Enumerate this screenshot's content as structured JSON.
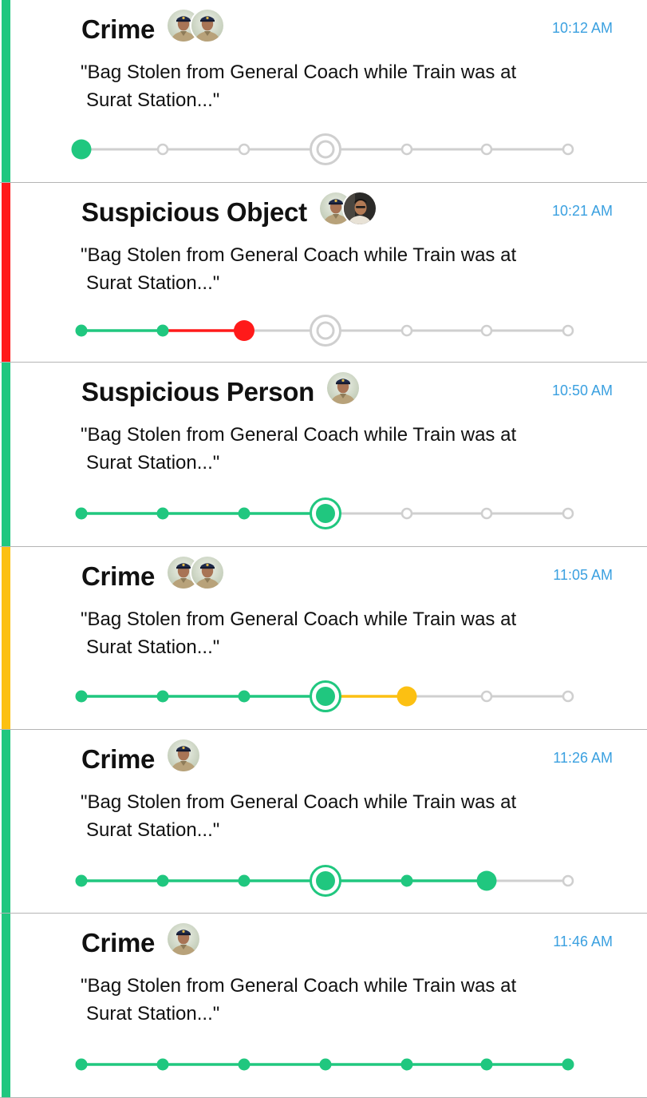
{
  "colors": {
    "green": "#20c77f",
    "red": "#ff1a1a",
    "yellow": "#fcc012",
    "grey": "#cfcfcf",
    "time": "#3aa0e0"
  },
  "incidents": [
    {
      "title": "Crime",
      "time": "10:12 AM",
      "desc_line1": "\"Bag Stolen from General Coach while Train was at",
      "desc_line2": "Surat Station...\"",
      "status_color": "green",
      "avatars": [
        "officer-photo",
        "officer-photo"
      ],
      "progress": {
        "nodes": [
          "active-green",
          "pending",
          "pending",
          "milestone-pending",
          "pending",
          "pending",
          "pending"
        ],
        "segments": [
          "grey",
          "grey",
          "grey",
          "grey",
          "grey",
          "grey"
        ]
      }
    },
    {
      "title": "Suspicious Object",
      "time": "10:21 AM",
      "desc_line1": "\"Bag Stolen from General Coach while Train was at",
      "desc_line2": "Surat Station...\"",
      "status_color": "red",
      "avatars": [
        "officer-photo",
        "person-photo"
      ],
      "progress": {
        "nodes": [
          "done-green",
          "done-green",
          "active-red",
          "milestone-pending",
          "pending",
          "pending",
          "pending"
        ],
        "segments": [
          "green",
          "red",
          "grey",
          "grey",
          "grey",
          "grey"
        ]
      }
    },
    {
      "title": "Suspicious Person",
      "time": "10:50 AM",
      "desc_line1": "\"Bag Stolen from General Coach while Train was at",
      "desc_line2": "Surat Station...\"",
      "status_color": "green",
      "avatars": [
        "officer-photo"
      ],
      "progress": {
        "nodes": [
          "done-green",
          "done-green",
          "done-green",
          "milestone-active",
          "pending",
          "pending",
          "pending"
        ],
        "segments": [
          "green",
          "green",
          "green",
          "grey",
          "grey",
          "grey"
        ]
      }
    },
    {
      "title": "Crime",
      "time": "11:05 AM",
      "desc_line1": "\"Bag Stolen from General Coach while Train was at",
      "desc_line2": "Surat Station...\"",
      "status_color": "yellow",
      "avatars": [
        "officer-photo",
        "officer-photo"
      ],
      "progress": {
        "nodes": [
          "done-green",
          "done-green",
          "done-green",
          "milestone-active",
          "active-yellow",
          "pending",
          "pending"
        ],
        "segments": [
          "green",
          "green",
          "green",
          "yellow",
          "grey",
          "grey"
        ]
      }
    },
    {
      "title": "Crime",
      "time": "11:26 AM",
      "desc_line1": "\"Bag Stolen from General Coach while Train was at",
      "desc_line2": "Surat Station...\"",
      "status_color": "green",
      "avatars": [
        "officer-photo"
      ],
      "progress": {
        "nodes": [
          "done-green",
          "done-green",
          "done-green",
          "milestone-active",
          "done-green",
          "active-green",
          "pending"
        ],
        "segments": [
          "green",
          "green",
          "green",
          "green",
          "green",
          "grey"
        ]
      }
    },
    {
      "title": "Crime",
      "time": "11:46 AM",
      "desc_line1": "\"Bag Stolen from General Coach while Train was at",
      "desc_line2": "Surat Station...\"",
      "status_color": "green",
      "avatars": [
        "officer-photo"
      ],
      "progress": {
        "nodes": [
          "done-green",
          "done-green",
          "done-green",
          "done-green",
          "done-green",
          "done-green",
          "done-green"
        ],
        "segments": [
          "green",
          "green",
          "green",
          "green",
          "green",
          "green"
        ]
      }
    }
  ]
}
